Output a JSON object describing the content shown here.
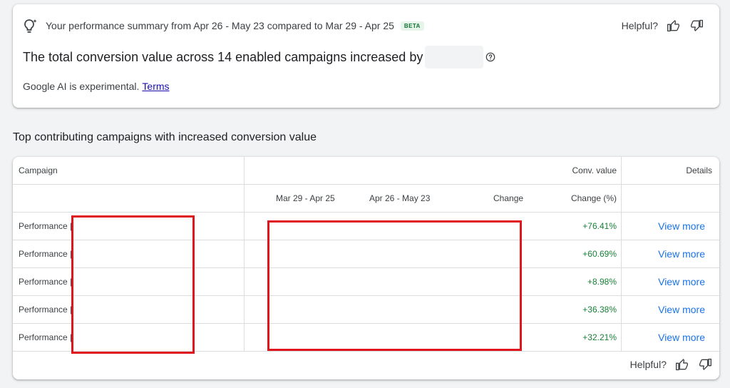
{
  "summary": {
    "period_header": "Your performance summary from Apr 26 - May 23 compared to Mar 29 - Apr 25",
    "beta": "BETA",
    "helpful": "Helpful?",
    "headline": "The total conversion value across 14 enabled campaigns increased by",
    "ai_note": "Google AI is experimental.",
    "terms_link": "Terms"
  },
  "section_title": "Top contributing campaigns with increased conversion value",
  "table": {
    "header_row1": {
      "campaign": "Campaign",
      "conv_value": "Conv. value",
      "details": "Details"
    },
    "header_row2": {
      "period_before": "Mar 29 - Apr 25",
      "period_after": "Apr 26 - May 23",
      "change": "Change",
      "change_pct": "Change (%)"
    },
    "rows": [
      {
        "campaign": "Performance |",
        "change_pct": "+76.41%",
        "details": "View more"
      },
      {
        "campaign": "Performance |",
        "change_pct": "+60.69%",
        "details": "View more"
      },
      {
        "campaign": "Performance |",
        "change_pct": "+8.98%",
        "details": "View more"
      },
      {
        "campaign": "Performance |",
        "change_pct": "+36.38%",
        "details": "View more"
      },
      {
        "campaign": "Performance |",
        "change_pct": "+32.21%",
        "details": "View more"
      }
    ],
    "helpful": "Helpful?"
  },
  "icons": [
    "lightbulb-sparkle-icon",
    "help-circle-icon",
    "thumb-up-icon",
    "thumb-down-icon"
  ],
  "colors": {
    "positive": "#188038",
    "link": "#1a73e8",
    "redaction_box": "#e0161e",
    "beta_bg": "#e6f4ea"
  }
}
